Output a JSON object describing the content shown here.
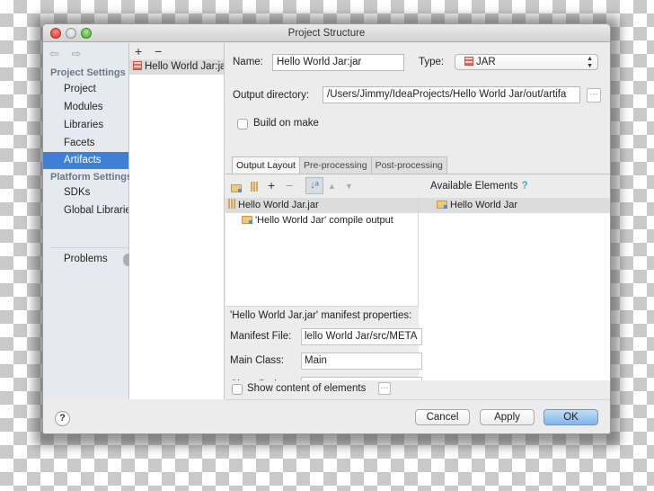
{
  "window": {
    "title": "Project Structure"
  },
  "sidebar": {
    "back_icon": "⇦",
    "forward_icon": "⇨",
    "project_settings_header": "Project Settings",
    "project_items": [
      {
        "label": "Project"
      },
      {
        "label": "Modules"
      },
      {
        "label": "Libraries"
      },
      {
        "label": "Facets"
      },
      {
        "label": "Artifacts",
        "selected": true
      }
    ],
    "platform_settings_header": "Platform Settings",
    "platform_items": [
      {
        "label": "SDKs"
      },
      {
        "label": "Global Libraries"
      }
    ],
    "problems_label": "Problems"
  },
  "artifact_list": {
    "add_label": "+",
    "remove_label": "−",
    "items": [
      {
        "label": "Hello World Jar:jar",
        "selected": true
      }
    ]
  },
  "artifact_form": {
    "name_label": "Name:",
    "name_value": "Hello World Jar:jar",
    "type_label": "Type:",
    "type_value": "JAR",
    "output_dir_label": "Output directory:",
    "output_dir_value": "/Users/Jimmy/IdeaProjects/Hello World Jar/out/artifa",
    "browse_label": "···",
    "build_on_make_label": "Build on make",
    "build_on_make_checked": false
  },
  "tabs": [
    {
      "label": "Output Layout",
      "active": true
    },
    {
      "label": "Pre-processing",
      "active": false
    },
    {
      "label": "Post-processing",
      "active": false
    }
  ],
  "output_layout": {
    "toolbar": {
      "add_icon": "+",
      "remove_icon": "−",
      "sort_icon": "↓ᵃ",
      "up_icon": "▲",
      "down_icon": "▼"
    },
    "tree": [
      {
        "label": "Hello World Jar.jar",
        "selected": true,
        "level": 0
      },
      {
        "label": "'Hello World Jar' compile output",
        "selected": false,
        "level": 1
      }
    ],
    "available_header": "Available Elements",
    "available_help": "?",
    "available_items": [
      {
        "label": "Hello World Jar",
        "selected": true
      }
    ]
  },
  "manifest": {
    "header": "'Hello World Jar.jar' manifest properties:",
    "manifest_file_label": "Manifest File:",
    "manifest_file_value": "lello World Jar/src/META",
    "main_class_label": "Main Class:",
    "main_class_value": "Main",
    "class_path_label": "Class Path:",
    "class_path_value": "",
    "show_content_label": "Show content of elements",
    "show_content_checked": false,
    "show_content_btn": "···"
  },
  "footer": {
    "help_label": "?",
    "cancel_label": "Cancel",
    "apply_label": "Apply",
    "ok_label": "OK"
  }
}
